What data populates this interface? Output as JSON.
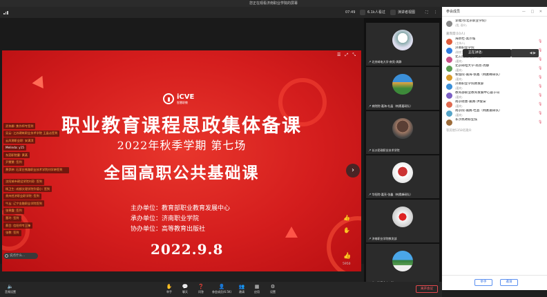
{
  "window": {
    "title": "您正在观看济南职业学院的屏幕"
  },
  "topbar": {
    "time": "07:49",
    "viewers": "6.1k人看过",
    "speaker_view": "演讲者视图",
    "participants_tab": "参会成员"
  },
  "slide": {
    "logo_name": "iCVE",
    "logo_sub": "智慧职教",
    "title": "职业教育课程思政集体备课",
    "subtitle": "2022年秋季学期  第七场",
    "banner": "全国高职公共基础课",
    "org_lines": [
      "主办单位：教育部职业教育发展中心",
      "承办单位：济南职业学院",
      "协办单位：高等教育出版社"
    ],
    "date": "2022.9.8"
  },
  "chat": {
    "messages": [
      "武伟娜: 焦作师专签到",
      "吴云: 江苏建筑职业技术学院 王晶洁签到",
      "云风潮职业职: 安满滨",
      "Melinda: y15",
      "东莞职院曹: 黄蒸",
      "尹慧慧: 签到",
      "黄伊婷: 石家庄铁路职业技术学院刘学婷签到",
      "沈阳城市建设学院刘奇: 签到",
      "杨卫生: 成都文理学院华德小: 签到",
      "贵州经济职业职学院: 签到",
      "牛丛: 辽宁金融职业学院签到",
      "张翠霞: 签到",
      "董玲: 签到",
      "蔡目: 信阳师专王锋",
      "张教: 签到"
    ],
    "input_placeholder": "说点什么...",
    "like_count": "5950"
  },
  "video_tiles": [
    {
      "label": "北京邮电大学-南亮-周静"
    },
    {
      "label": "商院院-嘉海-杜晶（韩素嘉研队）"
    },
    {
      "label": "长沙民政职业技术学院"
    },
    {
      "label": "华阳院-嘉亮-张鑫（韩素峰研队）"
    },
    {
      "label": "济南职业学院教发部"
    },
    {
      "label": "北工院宿舍宾三院"
    }
  ],
  "participants": {
    "host": {
      "name": "李福河(北京职业学院)",
      "role": "(我, 观众)"
    },
    "section_label": "嘉宾席(10人)",
    "guests": [
      {
        "name": "海新杜-黑沙城",
        "role": "(主持人)",
        "color": "#e05b3a"
      },
      {
        "name": "济南职业学院",
        "role": "(联席主持人)",
        "color": "#2f7de1"
      },
      {
        "name": "北工院南宾页三院",
        "role": "(嘉宾)",
        "color": "#c94f87"
      },
      {
        "name": "北京邮电大学-南亮-周静",
        "role": "(嘉宾)",
        "color": "#5a9d52"
      },
      {
        "name": "黎韶院-嘉海-张鑫（韩素峰研队）",
        "role": "(嘉宾)",
        "color": "#d99b2b"
      },
      {
        "name": "济南职业学院教发部",
        "role": "(嘉宾)",
        "color": "#3b8fd8"
      },
      {
        "name": "教育部职业教育发展中心晨于山",
        "role": "(嘉宾)",
        "color": "#7b5fc4"
      },
      {
        "name": "南京晓墨-嘉典-洪俊安",
        "role": "(嘉宾)",
        "color": "#e06a50"
      },
      {
        "name": "南京院-嘉典-杜晶（韩素嘉研队）",
        "role": "(嘉宾)",
        "color": "#55a4c8"
      },
      {
        "name": "长沙民政职业技",
        "role": "",
        "color": "#9d6c3a"
      }
    ],
    "more_text": "等其他5358名观众",
    "tooltip_text": "正在讲话:",
    "btn_raise": "举手",
    "btn_invite": "邀请"
  },
  "bottombar": {
    "audio_settings": "音频设置",
    "buttons": [
      "举手",
      "聊天",
      "问答",
      "参会成员(6.5K)",
      "邀请",
      "应用",
      "设置"
    ],
    "leave": "离开会议"
  }
}
